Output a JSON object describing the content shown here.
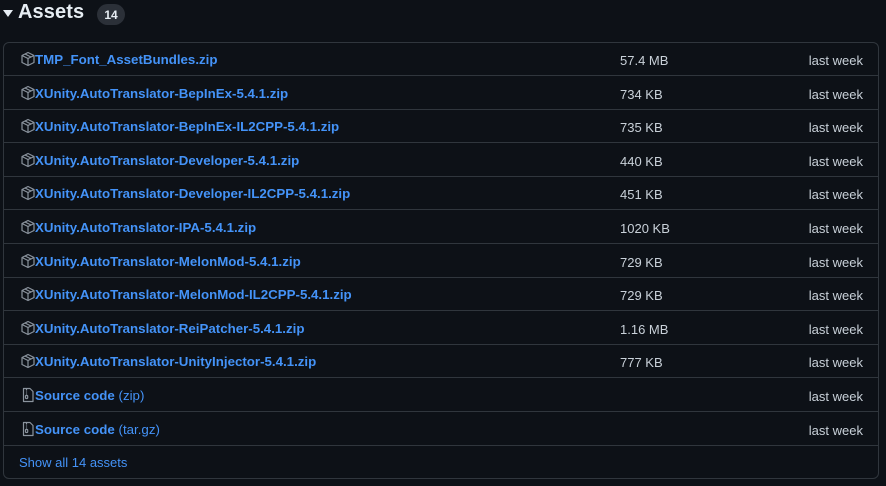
{
  "header": {
    "title": "Assets",
    "count": "14",
    "caret_icon": "triangle-down-icon"
  },
  "assets": [
    {
      "name": "TMP_Font_AssetBundles.zip",
      "suffix": "",
      "size": "57.4 MB",
      "date": "last week",
      "icon": "package-icon"
    },
    {
      "name": "XUnity.AutoTranslator-BepInEx-5.4.1.zip",
      "suffix": "",
      "size": "734 KB",
      "date": "last week",
      "icon": "package-icon"
    },
    {
      "name": "XUnity.AutoTranslator-BepInEx-IL2CPP-5.4.1.zip",
      "suffix": "",
      "size": "735 KB",
      "date": "last week",
      "icon": "package-icon"
    },
    {
      "name": "XUnity.AutoTranslator-Developer-5.4.1.zip",
      "suffix": "",
      "size": "440 KB",
      "date": "last week",
      "icon": "package-icon"
    },
    {
      "name": "XUnity.AutoTranslator-Developer-IL2CPP-5.4.1.zip",
      "suffix": "",
      "size": "451 KB",
      "date": "last week",
      "icon": "package-icon"
    },
    {
      "name": "XUnity.AutoTranslator-IPA-5.4.1.zip",
      "suffix": "",
      "size": "1020 KB",
      "date": "last week",
      "icon": "package-icon"
    },
    {
      "name": "XUnity.AutoTranslator-MelonMod-5.4.1.zip",
      "suffix": "",
      "size": "729 KB",
      "date": "last week",
      "icon": "package-icon"
    },
    {
      "name": "XUnity.AutoTranslator-MelonMod-IL2CPP-5.4.1.zip",
      "suffix": "",
      "size": "729 KB",
      "date": "last week",
      "icon": "package-icon"
    },
    {
      "name": "XUnity.AutoTranslator-ReiPatcher-5.4.1.zip",
      "suffix": "",
      "size": "1.16 MB",
      "date": "last week",
      "icon": "package-icon"
    },
    {
      "name": "XUnity.AutoTranslator-UnityInjector-5.4.1.zip",
      "suffix": "",
      "size": "777 KB",
      "date": "last week",
      "icon": "package-icon"
    },
    {
      "name": "Source code",
      "suffix": "(zip)",
      "size": "",
      "date": "last week",
      "icon": "file-zip-icon"
    },
    {
      "name": "Source code",
      "suffix": "(tar.gz)",
      "size": "",
      "date": "last week",
      "icon": "file-zip-icon"
    }
  ],
  "show_all": "Show all 14 assets",
  "colors": {
    "background": "#0d1117",
    "border": "#30363d",
    "link": "#4493f8",
    "text": "#c9d1d9",
    "badge": "#2b3038"
  }
}
